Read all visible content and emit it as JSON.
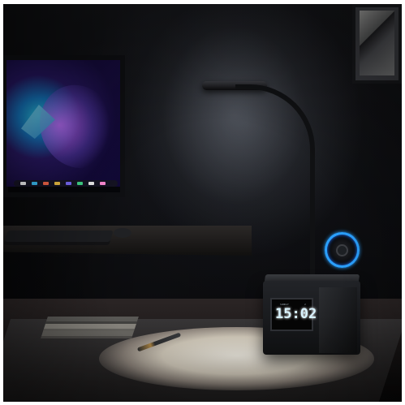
{
  "image": {
    "type": "desk lamp scene",
    "background_color": "#ffffff",
    "scene_colors": {
      "wall": "#18191d",
      "desk": "#2b2525",
      "light_pool": "#f5f1e7",
      "charger_glow": "#2aa0ff",
      "clock_digits": "#d9f4ff"
    }
  },
  "clock": {
    "time": "15:02",
    "small_text_left": "SUNDAY",
    "small_text_right": "2"
  },
  "monitor": {
    "dock_colors": [
      "#ffffff",
      "#3cc7ff",
      "#fe6a4b",
      "#f5c645",
      "#7c6cff",
      "#42da8b",
      "#f0f0f0",
      "#ff8bd4"
    ]
  },
  "icons": {
    "lamp": "desk-lamp-icon",
    "charger": "wireless-charger-icon",
    "clock": "digital-clock-icon",
    "pen": "pen-icon"
  }
}
